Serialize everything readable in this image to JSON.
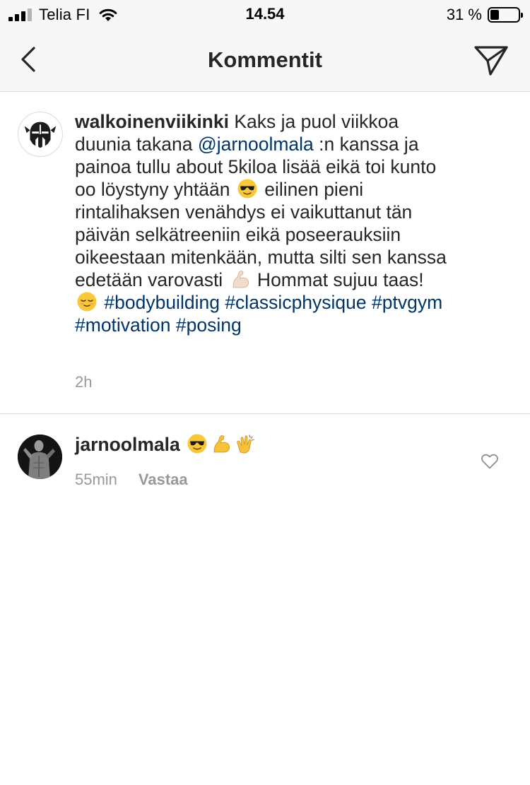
{
  "status_bar": {
    "carrier": "Telia FI",
    "time": "14.54",
    "battery_percent_text": "31 %",
    "battery_level": 0.31,
    "signal_bars_filled": 3,
    "signal_bars_total": 4
  },
  "header": {
    "title": "Kommentit",
    "back_icon": "chevron-left-icon",
    "send_icon": "paper-plane-icon"
  },
  "caption": {
    "username": "walkoinenviikinki",
    "text_1": " Kaks ja puol viikkoa duunia takana ",
    "mention": "@jarnoolmala",
    "text_2": " :n kanssa ja painoa tullu about 5kiloa lisää eikä toi kunto oo löystyny yhtään ",
    "emoji_1": "sunglasses-emoji",
    "text_3": " eilinen pieni rintalihaksen venähdys ei vaikuttanut tän päivän selkätreeniin eikä poseerauksiin oikeestaan mitenkään, mutta silti sen kanssa edetään varovasti ",
    "emoji_2": "flexed-biceps-emoji",
    "text_4": " Hommat sujuu taas! ",
    "emoji_3": "relieved-face-emoji",
    "hashtags": [
      "#bodybuilding",
      "#classicphysique",
      "#ptvgym",
      "#motivation",
      "#posing"
    ],
    "time_ago": "2h"
  },
  "reply": {
    "username": "jarnoolmala",
    "emojis": [
      "sunglasses-emoji",
      "flexed-biceps-emoji",
      "clapping-hands-emoji"
    ],
    "time_ago": "55min",
    "reply_label": "Vastaa",
    "like_icon": "heart-outline-icon"
  },
  "colors": {
    "text": "#262626",
    "link": "#003569",
    "secondary": "#999999",
    "divider": "#dbdbdb",
    "bar_background": "#f7f7f7"
  }
}
